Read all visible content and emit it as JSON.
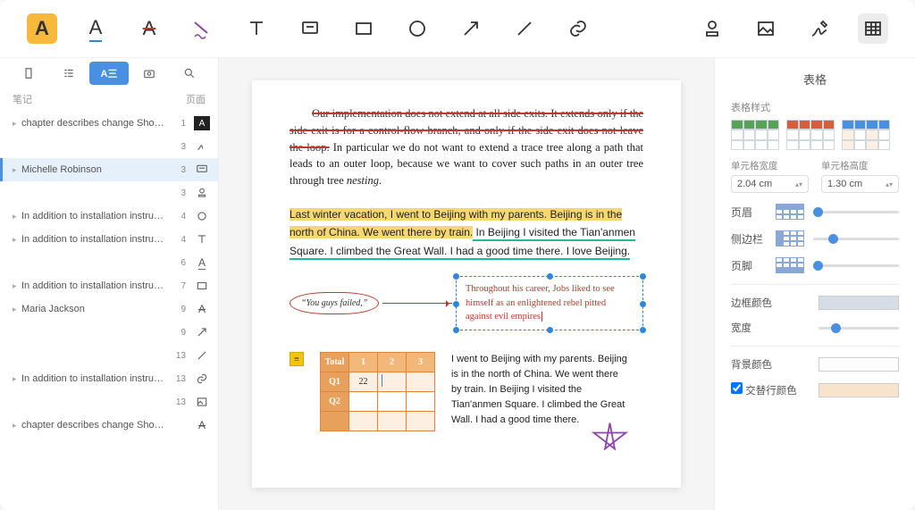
{
  "toolbar": {
    "tools": [
      {
        "name": "highlight-icon",
        "glyph": "A",
        "active": true
      },
      {
        "name": "underline-icon",
        "glyph": "A"
      },
      {
        "name": "strikethrough-icon",
        "glyph": "A"
      },
      {
        "name": "squiggly-icon",
        "glyph": "✎"
      },
      {
        "name": "text-icon",
        "glyph": "T"
      },
      {
        "name": "note-icon",
        "glyph": "▭"
      },
      {
        "name": "rectangle-icon",
        "glyph": "▭"
      },
      {
        "name": "circle-icon",
        "glyph": "◯"
      },
      {
        "name": "arrow-icon",
        "glyph": "↗"
      },
      {
        "name": "line-icon",
        "glyph": "/"
      },
      {
        "name": "link-icon",
        "glyph": "🔗"
      }
    ],
    "tools_right": [
      {
        "name": "stamp-icon",
        "glyph": "⦿"
      },
      {
        "name": "image-icon",
        "glyph": "▧"
      },
      {
        "name": "signature-icon",
        "glyph": "✒"
      },
      {
        "name": "table-icon",
        "glyph": "▦",
        "active": true
      }
    ]
  },
  "sidebar": {
    "tabs": [
      "page-icon",
      "list-icon",
      "annotation-icon",
      "camera-icon",
      "search-icon"
    ],
    "active_tab": 2,
    "sub_left": "笔记",
    "sub_right": "页面",
    "notes": [
      {
        "label": "chapter describes change Sho…",
        "pg": "1",
        "glyph": "A-block",
        "tri": true
      },
      {
        "label": "",
        "pg": "3",
        "glyph": "signature",
        "indent": true
      },
      {
        "label": "Michelle Robinson",
        "pg": "3",
        "glyph": "comment",
        "sel": true,
        "tri": true
      },
      {
        "label": "",
        "pg": "3",
        "glyph": "stamp",
        "indent": true
      },
      {
        "label": "In addition to installation instru…",
        "pg": "4",
        "glyph": "circle",
        "tri": true
      },
      {
        "label": "In addition to installation instru…",
        "pg": "4",
        "glyph": "T",
        "tri": true
      },
      {
        "label": "",
        "pg": "6",
        "glyph": "A-ul",
        "indent": true
      },
      {
        "label": "In addition to installation instru…",
        "pg": "7",
        "glyph": "rect",
        "tri": true
      },
      {
        "label": "Maria Jackson",
        "pg": "9",
        "glyph": "A-strike",
        "tri": true
      },
      {
        "label": "",
        "pg": "9",
        "glyph": "arrow",
        "indent": true
      },
      {
        "label": "",
        "pg": "13",
        "glyph": "line",
        "indent": true
      },
      {
        "label": "In addition to installation instru…",
        "pg": "13",
        "glyph": "link",
        "tri": true
      },
      {
        "label": "",
        "pg": "13",
        "glyph": "image",
        "indent": true
      },
      {
        "label": "chapter describes change Sho…",
        "pg": "",
        "glyph": "A-strike",
        "tri": true
      }
    ]
  },
  "doc": {
    "struck": "Our implementation does not extend at all side exits. It extends only if the side exit is for a control-flow branch, and only if the side exit does not leave the loop.",
    "para1_rest": " In particular we do not want to extend a trace tree along a path that leads to an outer loop, because we want to cover such paths in an outer tree through tree ",
    "para1_em": "nesting",
    "hl_text": "Last winter vacation, I went to Beijing with my parents. Beijing is in the north of China. We went there by train.",
    "ul_text": " In Beijing I visited the Tian'anmen Square. I climbed the Great Wall. I had a good time there. I love Beijing.",
    "quote": "“You guys failed,”",
    "textbox": "Throughout his career, Jobs liked to see himself as an enlightened rebel pitted against evil empires",
    "table": {
      "headers": [
        "Total",
        "1",
        "2",
        "3"
      ],
      "rows": [
        {
          "h": "Q1",
          "cells": [
            "22",
            "",
            ""
          ]
        },
        {
          "h": "Q2",
          "cells": [
            "",
            "",
            ""
          ]
        },
        {
          "h": "",
          "cells": [
            "",
            "",
            ""
          ]
        }
      ]
    },
    "right_para": "I went to Beijing with my parents. Beijing is in the north of China. We went there by train. In Beijing I visited the Tian'anmen Square. I climbed the Great Wall. I had a good time there."
  },
  "panel": {
    "title": "表格",
    "style_label": "表格样式",
    "cell_w_label": "单元格宽度",
    "cell_w": "2.04 cm",
    "cell_h_label": "单元格高度",
    "cell_h": "1.30 cm",
    "header_label": "页眉",
    "sidebar_label": "侧边栏",
    "footer_label": "页脚",
    "border_color_label": "边框颜色",
    "width_label": "宽度",
    "bg_label": "背景颜色",
    "alt_label": "交替行颜色",
    "colors": {
      "border": "#a9b7c8",
      "bg": "#ffffff",
      "alt": "#f8e4cc"
    }
  }
}
